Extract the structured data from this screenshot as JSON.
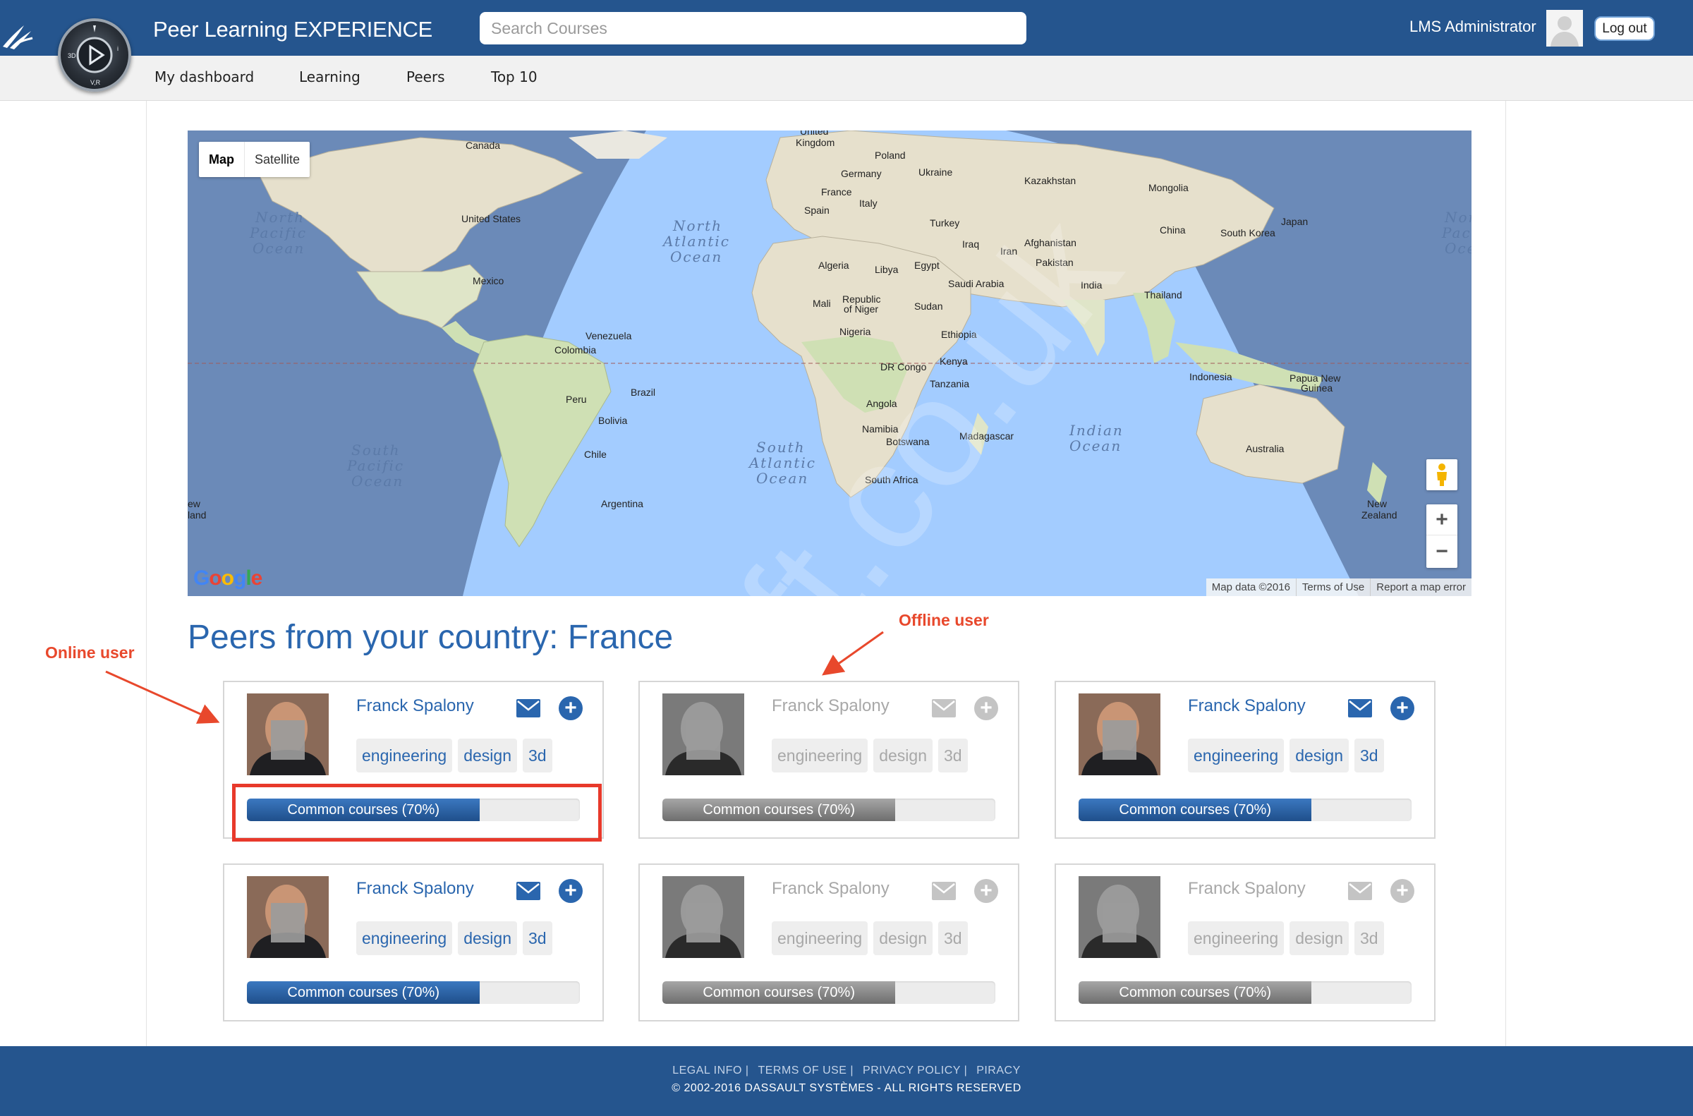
{
  "header": {
    "app_title": "Peer Learning EXPERIENCE",
    "search_placeholder": "Search Courses",
    "user_name": "LMS Administrator",
    "logout_label": "Log out"
  },
  "nav": {
    "items": [
      {
        "label": "My dashboard"
      },
      {
        "label": "Learning"
      },
      {
        "label": "Peers"
      },
      {
        "label": "Top 10"
      }
    ]
  },
  "map": {
    "type_controls": [
      "Map",
      "Satellite"
    ],
    "active_type": "Map",
    "google_logo": "Google",
    "footer": [
      "Map data ©2016",
      "Terms of Use",
      "Report a map error"
    ],
    "zoom_in": "+",
    "zoom_out": "−",
    "labels": {
      "canada": "Canada",
      "united_states": "United States",
      "mexico": "Mexico",
      "venezuela": "Venezuela",
      "colombia": "Colombia",
      "brazil": "Brazil",
      "peru": "Peru",
      "bolivia": "Bolivia",
      "chile": "Chile",
      "argentina": "Argentina",
      "united_kingdom_1": "United",
      "united_kingdom_2": "Kingdom",
      "poland": "Poland",
      "germany": "Germany",
      "ukraine": "Ukraine",
      "france": "France",
      "italy": "Italy",
      "spain": "Spain",
      "turkey": "Turkey",
      "iraq": "Iraq",
      "iran": "Iran",
      "kazakhstan": "Kazakhstan",
      "mongolia": "Mongolia",
      "china": "China",
      "south_korea": "South Korea",
      "japan": "Japan",
      "afghanistan": "Afghanistan",
      "pakistan": "Pakistan",
      "india": "India",
      "thailand": "Thailand",
      "algeria": "Algeria",
      "libya": "Libya",
      "egypt": "Egypt",
      "saudi_arabia": "Saudi Arabia",
      "mali": "Mali",
      "niger_1": "Republic",
      "niger_2": "of Niger",
      "sudan": "Sudan",
      "nigeria": "Nigeria",
      "ethiopia": "Ethiopia",
      "dr_congo": "DR Congo",
      "kenya": "Kenya",
      "tanzania": "Tanzania",
      "angola": "Angola",
      "namibia": "Namibia",
      "botswana": "Botswana",
      "madagascar": "Madagascar",
      "south_africa": "South Africa",
      "indonesia": "Indonesia",
      "papua_1": "Papua New",
      "papua_2": "Guinea",
      "australia": "Australia",
      "new_zealand_1": "New",
      "new_zealand_2": "Zealand",
      "nz_left_1": "ew",
      "nz_left_2": "land",
      "north_pacific_1": "North",
      "north_pacific_2": "Pacific",
      "north_pacific_3": "Ocean",
      "north_atlantic_1": "North",
      "north_atlantic_2": "Atlantic",
      "north_atlantic_3": "Ocean",
      "south_pacific_1": "South",
      "south_pacific_2": "Pacific",
      "south_pacific_3": "Ocean",
      "south_atlantic_1": "South",
      "south_atlantic_2": "Atlantic",
      "south_atlantic_3": "Ocean",
      "indian_1": "Indian",
      "indian_2": "Ocean",
      "np_right_1": "Nor",
      "np_right_2": "Pac",
      "np_right_3": "Oce"
    }
  },
  "watermark": "ft.co.uk",
  "section": {
    "title": "Peers from your country: France"
  },
  "annotations": {
    "online": "Online user",
    "offline": "Offline user"
  },
  "peers": [
    {
      "name": "Franck Spalony",
      "status": "online",
      "tags": [
        "engineering",
        "design",
        "3d"
      ],
      "progress_label": "Common courses (70%)",
      "progress": 0.7
    },
    {
      "name": "Franck Spalony",
      "status": "offline",
      "tags": [
        "engineering",
        "design",
        "3d"
      ],
      "progress_label": "Common courses (70%)",
      "progress": 0.7
    },
    {
      "name": "Franck Spalony",
      "status": "online",
      "tags": [
        "engineering",
        "design",
        "3d"
      ],
      "progress_label": "Common courses (70%)",
      "progress": 0.7
    },
    {
      "name": "Franck Spalony",
      "status": "online",
      "tags": [
        "engineering",
        "design",
        "3d"
      ],
      "progress_label": "Common courses (70%)",
      "progress": 0.7
    },
    {
      "name": "Franck Spalony",
      "status": "offline",
      "tags": [
        "engineering",
        "design",
        "3d"
      ],
      "progress_label": "Common courses (70%)",
      "progress": 0.7
    },
    {
      "name": "Franck Spalony",
      "status": "offline",
      "tags": [
        "engineering",
        "design",
        "3d"
      ],
      "progress_label": "Common courses (70%)",
      "progress": 0.7
    }
  ],
  "footer": {
    "links": [
      "LEGAL INFO |",
      "TERMS OF USE |",
      "PRIVACY POLICY |",
      "PIRACY"
    ],
    "copyright": "© 2002-2016 DASSAULT SYSTÈMES - ALL RIGHTS RESERVED"
  },
  "colors": {
    "header_blue": "#25558e",
    "link_blue": "#2a66ae",
    "annotation_red": "#e8482c",
    "offline_gray": "#a8a8a8"
  }
}
